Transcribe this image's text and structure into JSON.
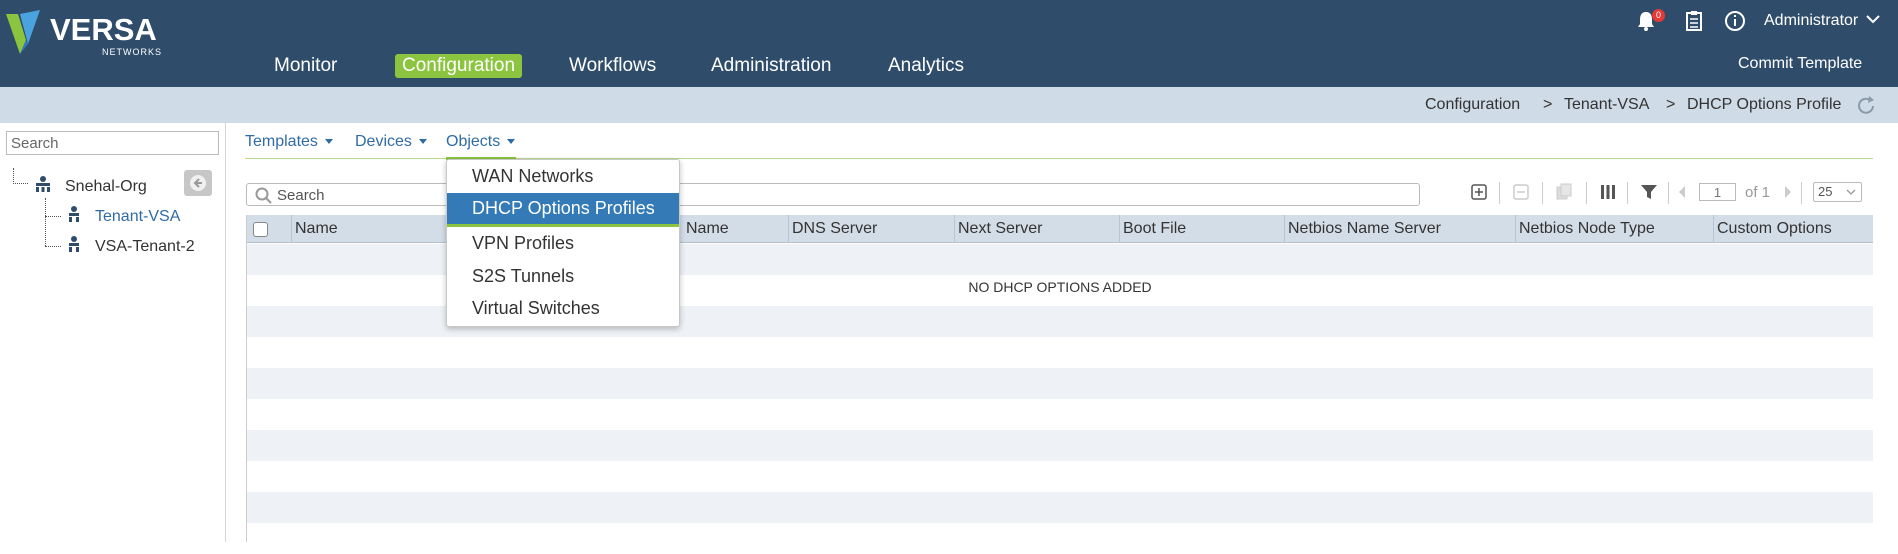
{
  "brand": {
    "name": "VERSA",
    "sub": "NETWORKS"
  },
  "nav": {
    "items": [
      {
        "label": "Monitor"
      },
      {
        "label": "Configuration",
        "active": true
      },
      {
        "label": "Workflows"
      },
      {
        "label": "Administration"
      },
      {
        "label": "Analytics"
      }
    ]
  },
  "header": {
    "notification_count": "0",
    "user": "Administrator",
    "commit_label": "Commit Template"
  },
  "breadcrumb": {
    "items": [
      "Configuration",
      "Tenant-VSA",
      "DHCP Options Profile"
    ],
    "separator": ">"
  },
  "tree": {
    "search_placeholder": "Search",
    "root": "Snehal-Org",
    "children": [
      "Tenant-VSA",
      "VSA-Tenant-2"
    ],
    "selected": "Tenant-VSA"
  },
  "subnav": {
    "items": [
      {
        "label": "Templates"
      },
      {
        "label": "Devices"
      },
      {
        "label": "Objects",
        "active": true
      }
    ]
  },
  "grid": {
    "search_placeholder": "Search",
    "page": "1",
    "page_of": "of 1",
    "page_size": "25",
    "columns": [
      "Name",
      "Name",
      "DNS Server",
      "Next Server",
      "Boot File",
      "Netbios Name Server",
      "Netbios Node Type",
      "Custom Options"
    ],
    "empty_message": "NO DHCP OPTIONS ADDED"
  },
  "dropdown": {
    "items": [
      "WAN Networks",
      "DHCP Options Profiles",
      "VPN Profiles",
      "S2S Tunnels",
      "Virtual Switches"
    ],
    "selected": "DHCP Options Profiles"
  },
  "colors": {
    "header_bg": "#2f4d6b",
    "accent_green": "#8bc43f",
    "selected_blue": "#337ab7",
    "link_blue": "#2f6ca6",
    "badge_red": "#e53935"
  },
  "icons": [
    "bell-icon",
    "clipboard-icon",
    "info-icon",
    "chevron-down-icon",
    "refresh-icon",
    "search-icon",
    "back-arrow-icon",
    "org-icon",
    "tenant-icon",
    "add-icon",
    "remove-icon",
    "copy-icon",
    "columns-icon",
    "filter-icon",
    "prev-page-icon",
    "next-page-icon"
  ]
}
